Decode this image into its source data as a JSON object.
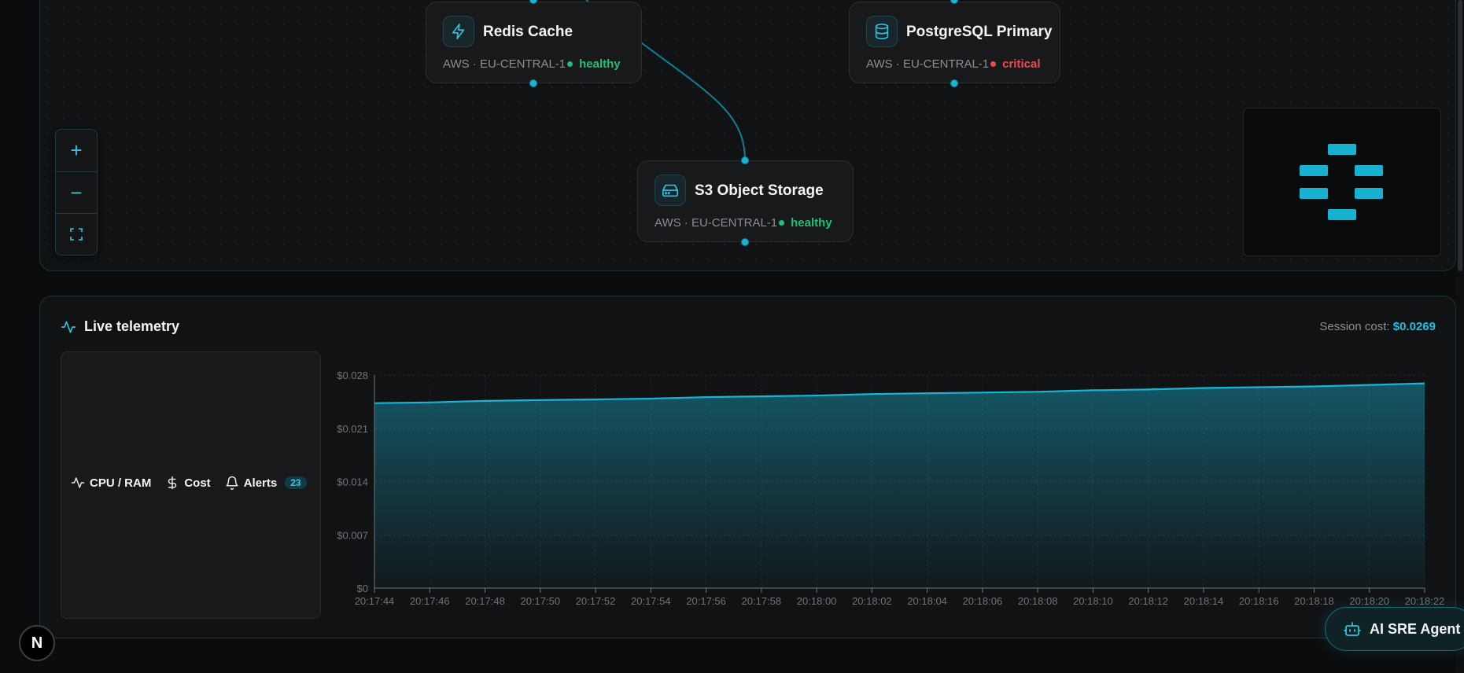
{
  "nodes": [
    {
      "name": "Redis Cache",
      "provider": "AWS · EU-CENTRAL-1",
      "status": "healthy",
      "icon": "lightning-icon"
    },
    {
      "name": "PostgreSQL Primary",
      "provider": "AWS · EU-CENTRAL-1",
      "status": "critical",
      "icon": "database-icon"
    },
    {
      "name": "S3 Object Storage",
      "provider": "AWS · EU-CENTRAL-1",
      "status": "healthy",
      "icon": "hard-drive-icon"
    }
  ],
  "colors": {
    "accent": "#19b4d4",
    "healthy": "#1fbf7a",
    "critical": "#ef4a4a",
    "background": "#0b0c0e"
  },
  "zoom_controls": [
    {
      "label": "+",
      "icon": "zoom-in-icon"
    },
    {
      "label": "−",
      "icon": "zoom-out-icon"
    },
    {
      "label": "",
      "icon": "fit-view-icon"
    }
  ],
  "telemetry": {
    "title": "Live telemetry",
    "icon": "activity-icon",
    "session_cost_label": "Session cost:",
    "session_cost_value": "$0.0269",
    "tabs": [
      {
        "label": "CPU / RAM",
        "icon": "activity-icon"
      },
      {
        "label": "Cost",
        "icon": "dollar-icon"
      },
      {
        "label": "Alerts",
        "icon": "bell-icon",
        "badge": "23"
      }
    ]
  },
  "chart_data": {
    "type": "area",
    "title": "",
    "xlabel": "",
    "ylabel": "",
    "x": [
      "20:17:44",
      "20:17:46",
      "20:17:48",
      "20:17:50",
      "20:17:52",
      "20:17:54",
      "20:17:56",
      "20:17:58",
      "20:18:00",
      "20:18:02",
      "20:18:04",
      "20:18:06",
      "20:18:08",
      "20:18:10",
      "20:18:12",
      "20:18:14",
      "20:18:16",
      "20:18:18",
      "20:18:20",
      "20:18:22"
    ],
    "values": [
      0.0243,
      0.0244,
      0.0246,
      0.0247,
      0.0248,
      0.0249,
      0.0251,
      0.0252,
      0.0253,
      0.0255,
      0.0256,
      0.0257,
      0.0258,
      0.026,
      0.0261,
      0.0263,
      0.0264,
      0.0265,
      0.0267,
      0.0269
    ],
    "yticks": [
      "$0",
      "$0.007",
      "$0.014",
      "$0.021",
      "$0.028"
    ],
    "ylim": [
      0,
      0.028
    ],
    "grid": true,
    "color": "#19b4d4"
  },
  "floating": {
    "next_badge": "N",
    "agent_button": "AI SRE Agent",
    "agent_icon": "bot-icon"
  }
}
